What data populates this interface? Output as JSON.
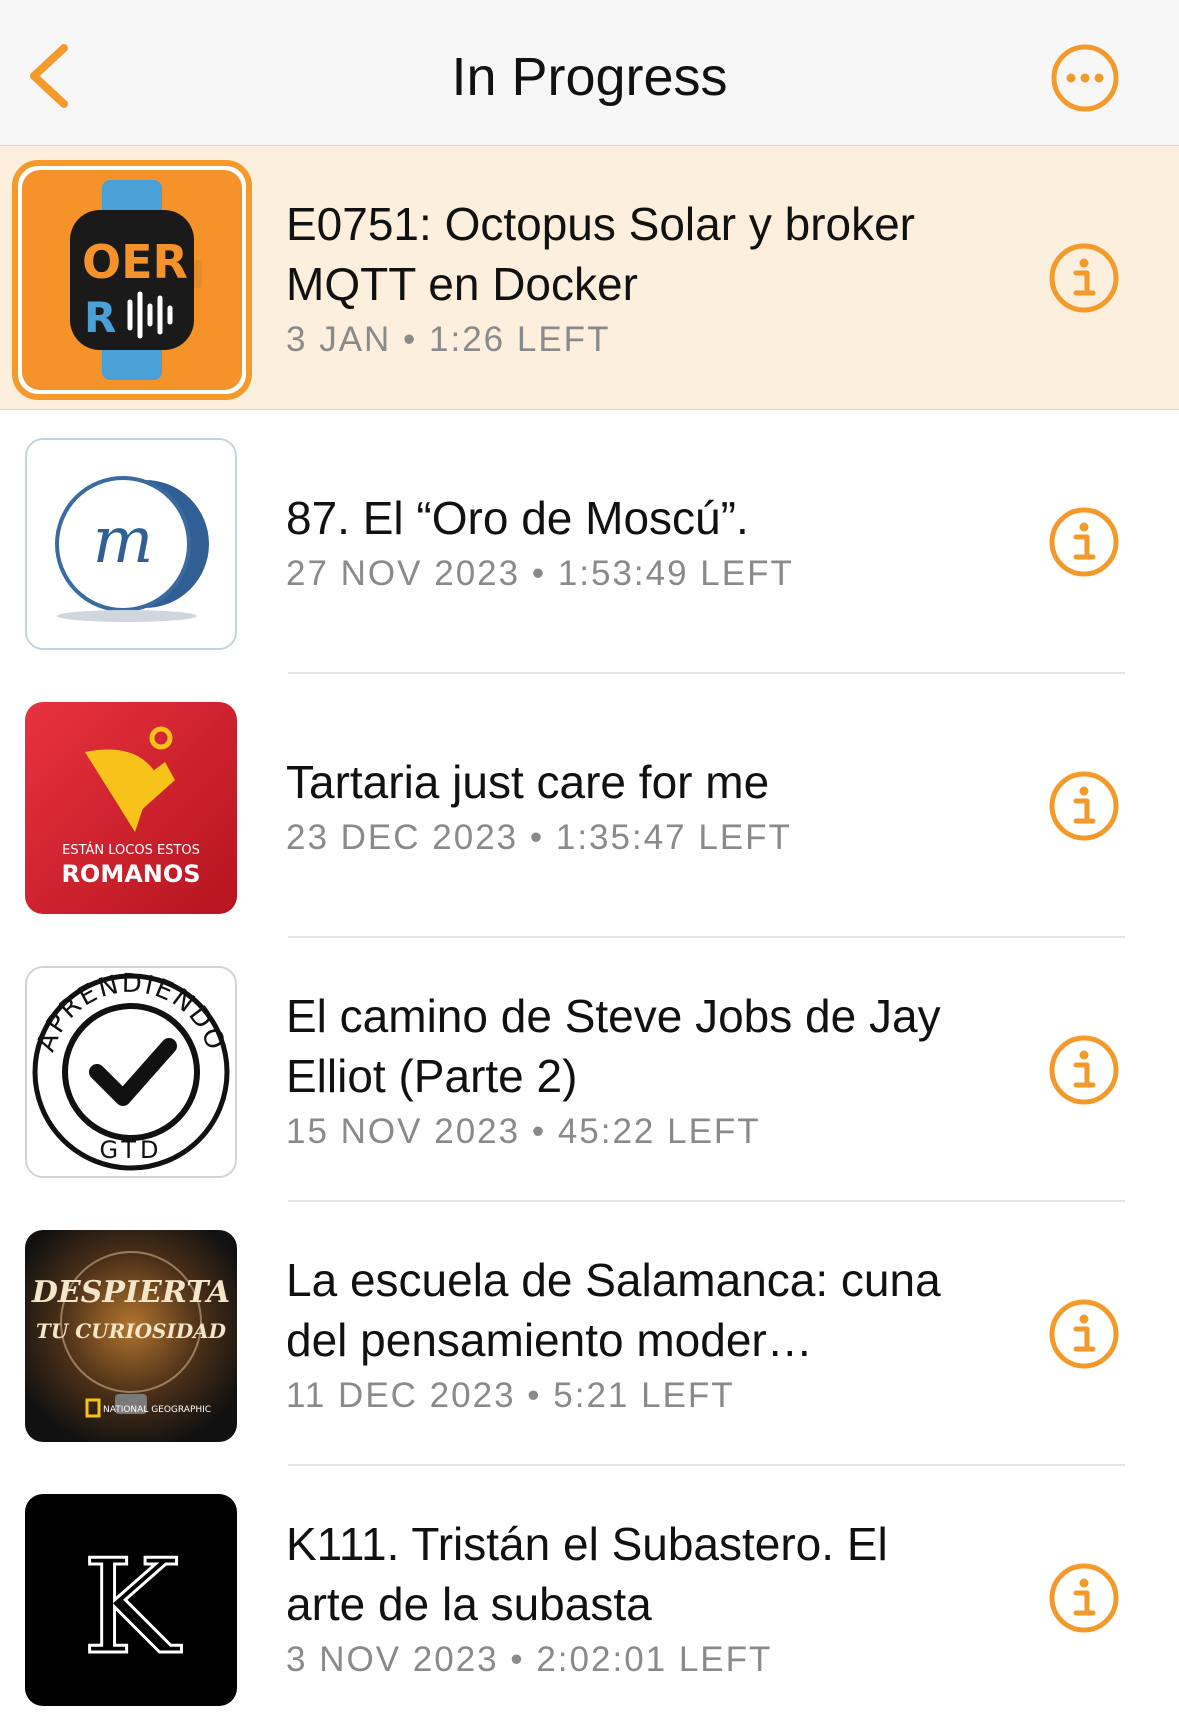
{
  "nav": {
    "title": "In Progress",
    "back_icon": "chevron-left-icon",
    "more_icon": "ellipsis-circle-icon"
  },
  "accent_color": "#f39a2b",
  "episodes": [
    {
      "title": "E0751: Octopus Solar y broker MQTT en Docker",
      "date": "3 JAN",
      "remaining": "1:26 LEFT",
      "artwork": "podcast-artwork-watch-ODR",
      "artwork_text": "OER",
      "playing": true
    },
    {
      "title": "87. El “Oro de Moscú”.",
      "date": "27 NOV 2023",
      "remaining": "1:53:49 LEFT",
      "artwork": "podcast-artwork-m-logo",
      "artwork_text": "m"
    },
    {
      "title": "Tartaria just care for me",
      "date": "23 DEC 2023",
      "remaining": "1:35:47 LEFT",
      "artwork": "podcast-artwork-romanos",
      "artwork_line1": "ESTÁN LOCOS ESTOS",
      "artwork_line2": "ROMANOS"
    },
    {
      "title": "El camino de Steve Jobs de Jay Elliot (Parte 2)",
      "date": "15 NOV 2023",
      "remaining": "45:22 LEFT",
      "artwork": "podcast-artwork-aprendiendo-gtd",
      "artwork_ring_top": "APRENDIENDO",
      "artwork_ring_bottom": "GTD"
    },
    {
      "title": "La escuela de Salamanca: cuna del pensamiento moder…",
      "date": "11 DEC 2023",
      "remaining": "5:21 LEFT",
      "artwork": "podcast-artwork-despierta-tu-curiosidad",
      "artwork_line1": "DESPIERTA",
      "artwork_line2": "TU CURIOSIDAD",
      "artwork_brand": "NATIONAL GEOGRAPHIC"
    },
    {
      "title": "K111. Tristán el Subastero. El arte de la subasta",
      "date": "3 NOV 2023",
      "remaining": "2:02:01 LEFT",
      "artwork": "podcast-artwork-k-logo",
      "artwork_text": "K"
    }
  ]
}
